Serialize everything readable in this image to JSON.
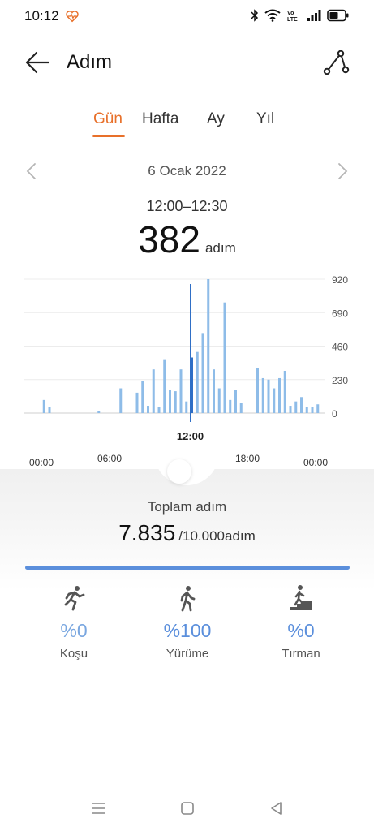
{
  "status_bar": {
    "time": "10:12",
    "icons": [
      "heart-rate-icon",
      "bluetooth-icon",
      "wifi-icon",
      "volte-icon",
      "signal-icon",
      "battery-icon"
    ],
    "volte_text": "Vo\nLTE"
  },
  "header": {
    "title": "Adım",
    "back_icon": "arrow-left-icon",
    "route_icon": "route-icon"
  },
  "tabs": [
    {
      "label": "Gün",
      "active": true
    },
    {
      "label": "Hafta",
      "active": false
    },
    {
      "label": "Ay",
      "active": false
    },
    {
      "label": "Yıl",
      "active": false
    }
  ],
  "date_nav": {
    "date": "6 Ocak 2022"
  },
  "selection": {
    "time_range": "12:00–12:30",
    "steps": "382",
    "unit": "adım"
  },
  "chart_data": {
    "type": "bar",
    "y_ticks": [
      "920",
      "690",
      "460",
      "230",
      "0"
    ],
    "ylim": [
      0,
      920
    ],
    "x_ticks": [
      "00:00",
      "06:00",
      "12:00",
      "18:00",
      "00:00"
    ],
    "selected_label": "12:00",
    "selected_time": 12.0,
    "accent_color": "#2f6fc6",
    "bar_color": "#8ebce8",
    "bars": [
      {
        "t": 1.5,
        "v": 90
      },
      {
        "t": 2.0,
        "v": 40
      },
      {
        "t": 6.5,
        "v": 15
      },
      {
        "t": 8.5,
        "v": 170
      },
      {
        "t": 10.0,
        "v": 140
      },
      {
        "t": 10.5,
        "v": 220
      },
      {
        "t": 11.0,
        "v": 50
      },
      {
        "t": 11.5,
        "v": 300
      },
      {
        "t": 12.0,
        "v": 40
      },
      {
        "t": 12.5,
        "v": 370
      },
      {
        "t": 13.0,
        "v": 160
      },
      {
        "t": 13.5,
        "v": 150
      },
      {
        "t": 14.0,
        "v": 300
      },
      {
        "t": 14.5,
        "v": 80
      },
      {
        "t": 15.0,
        "v": 382,
        "selected": true
      },
      {
        "t": 15.5,
        "v": 420
      },
      {
        "t": 16.0,
        "v": 550
      },
      {
        "t": 16.5,
        "v": 920
      },
      {
        "t": 17.0,
        "v": 300
      },
      {
        "t": 17.5,
        "v": 170
      },
      {
        "t": 18.0,
        "v": 760
      },
      {
        "t": 18.5,
        "v": 90
      },
      {
        "t": 19.0,
        "v": 160
      },
      {
        "t": 19.5,
        "v": 70
      },
      {
        "t": 21.0,
        "v": 310
      },
      {
        "t": 21.5,
        "v": 240
      },
      {
        "t": 22.0,
        "v": 230
      },
      {
        "t": 22.5,
        "v": 170
      },
      {
        "t": 23.0,
        "v": 240
      },
      {
        "t": 23.5,
        "v": 290
      },
      {
        "t": 24.0,
        "v": 50
      },
      {
        "t": 24.5,
        "v": 80
      },
      {
        "t": 25.0,
        "v": 110
      },
      {
        "t": 25.5,
        "v": 40
      },
      {
        "t": 26.0,
        "v": 40
      },
      {
        "t": 26.5,
        "v": 60
      }
    ]
  },
  "summary": {
    "total_label": "Toplam adım",
    "total_value": "7.835",
    "goal": "/10.000adım",
    "progress": 1.0,
    "progress_color": "#5b8fdc"
  },
  "activities": [
    {
      "icon": "running-icon",
      "percent": "%0",
      "label": "Koşu"
    },
    {
      "icon": "walking-icon",
      "percent": "%100",
      "label": "Yürüme"
    },
    {
      "icon": "climbing-icon",
      "percent": "%0",
      "label": "Tırman"
    }
  ],
  "nav_bar": {
    "icons": [
      "menu-icon",
      "home-icon",
      "back-icon"
    ]
  }
}
